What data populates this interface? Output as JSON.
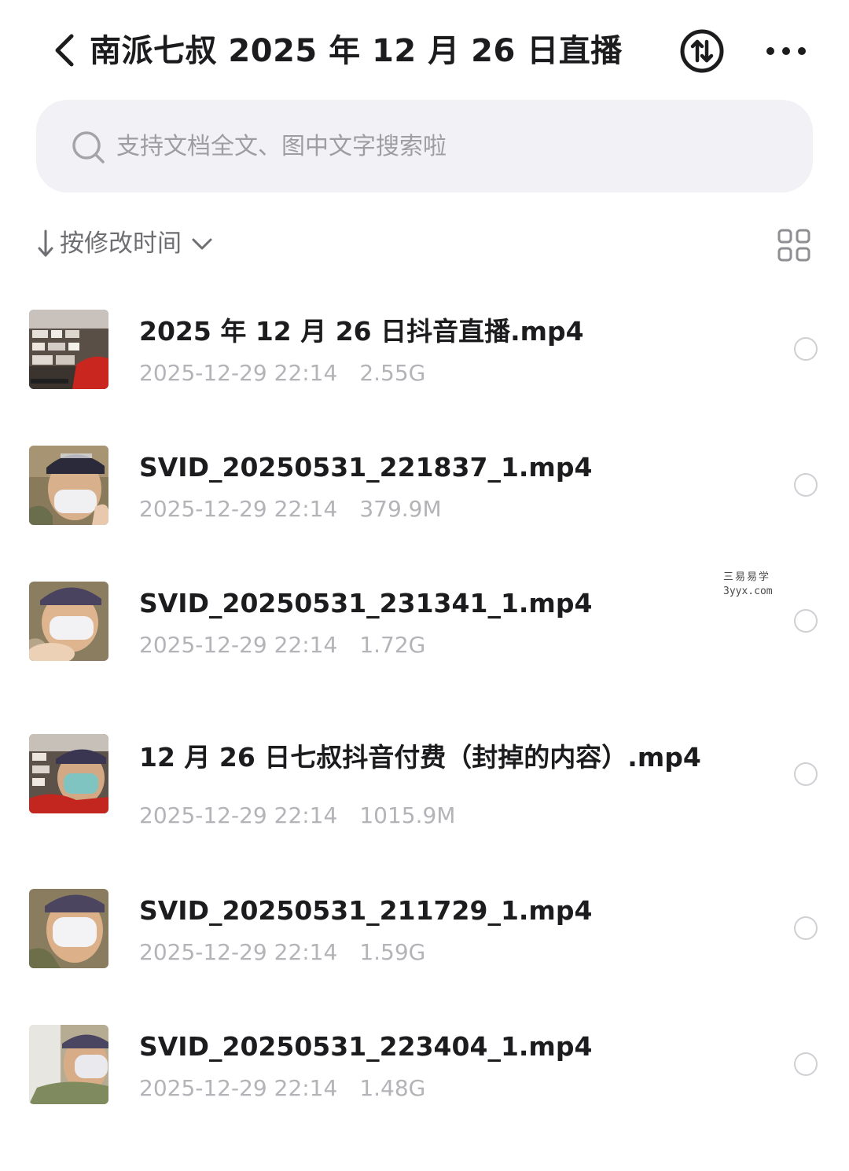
{
  "header": {
    "title": "南派七叔 2025 年 12 月 26 日直播"
  },
  "search": {
    "placeholder": "支持文档全文、图中文字搜索啦"
  },
  "sort": {
    "label": "按修改时间"
  },
  "files": [
    {
      "name": "2025 年 12 月 26 日抖音直播.mp4",
      "date": "2025-12-29 22:14",
      "size": "2.55G"
    },
    {
      "name": "SVID_20250531_221837_1.mp4",
      "date": "2025-12-29 22:14",
      "size": "379.9M"
    },
    {
      "name": "SVID_20250531_231341_1.mp4",
      "date": "2025-12-29 22:14",
      "size": "1.72G"
    },
    {
      "name": "12 月 26 日七叔抖音付费（封掉的内容）.mp4",
      "date": "2025-12-29 22:14",
      "size": "1015.9M"
    },
    {
      "name": "SVID_20250531_211729_1.mp4",
      "date": "2025-12-29 22:14",
      "size": "1.59G"
    },
    {
      "name": "SVID_20250531_223404_1.mp4",
      "date": "2025-12-29 22:14",
      "size": "1.48G"
    }
  ],
  "watermark": {
    "line1": "三易易学",
    "line2": "3yyx.com"
  },
  "icons": {
    "back": "chevron-left-icon",
    "sort_circle": "sort-arrows-circle-icon",
    "more": "more-dots-icon",
    "search": "search-icon",
    "sort_arrow": "arrow-down-icon",
    "chevron": "chevron-down-icon",
    "grid": "grid-view-icon"
  }
}
